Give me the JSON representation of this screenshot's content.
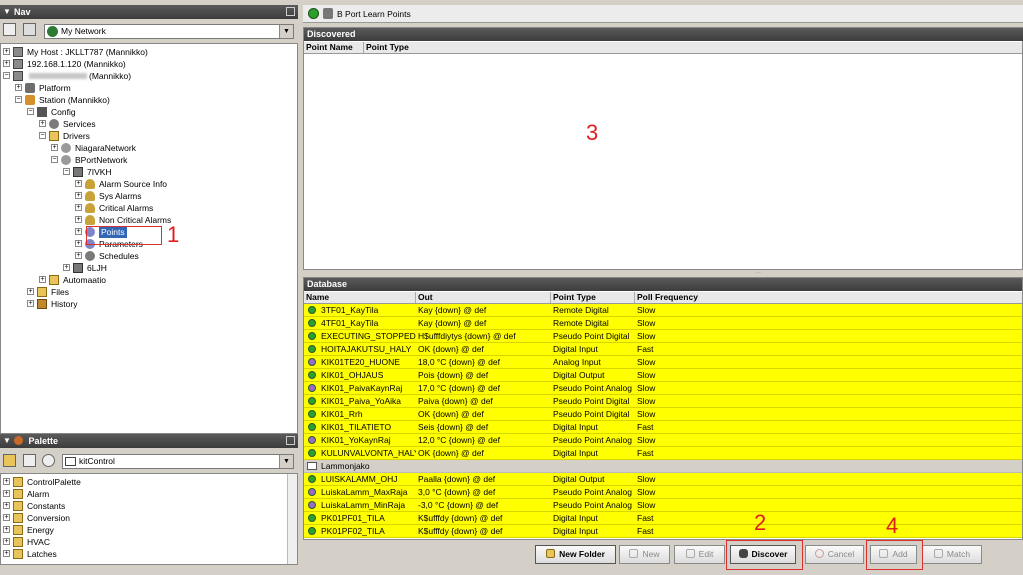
{
  "nav": {
    "title": "Nav",
    "network_combo": "My Network",
    "tree": [
      {
        "label": "My Host : JKLLT787 (Mannikko)"
      },
      {
        "label": "192.168.1.120 (Mannikko)"
      },
      {
        "label": "(Mannikko)"
      },
      {
        "label": "Platform"
      },
      {
        "label": "Station (Mannikko)"
      },
      {
        "label": "Config"
      },
      {
        "label": "Services"
      },
      {
        "label": "Drivers"
      },
      {
        "label": "NiagaraNetwork"
      },
      {
        "label": "BPortNetwork"
      },
      {
        "label": "7IVKH"
      },
      {
        "label": "Alarm Source Info"
      },
      {
        "label": "Sys Alarms"
      },
      {
        "label": "Critical Alarms"
      },
      {
        "label": "Non Critical Alarms"
      },
      {
        "label": "Points"
      },
      {
        "label": "Parameters"
      },
      {
        "label": "Schedules"
      },
      {
        "label": "6LJH"
      },
      {
        "label": "Automaatio"
      },
      {
        "label": "Files"
      },
      {
        "label": "History"
      }
    ]
  },
  "palette": {
    "title": "Palette",
    "combo": "kitControl",
    "items": [
      "ControlPalette",
      "Alarm",
      "Constants",
      "Conversion",
      "Energy",
      "HVAC",
      "Latches"
    ]
  },
  "view": {
    "title": "B Port Learn Points",
    "discovered": {
      "title": "Discovered",
      "columns": [
        "Point Name",
        "Point Type"
      ]
    },
    "database": {
      "title": "Database",
      "columns": [
        "Name",
        "Out",
        "Point Type",
        "Poll Frequency"
      ],
      "rows": [
        {
          "name": "3TF01_KayTila",
          "out": "Kay {down} @ def",
          "type": "Remote Digital",
          "poll": "Slow",
          "color": "#2ca02c"
        },
        {
          "name": "4TF01_KayTila",
          "out": "Kay {down} @ def",
          "type": "Remote Digital",
          "poll": "Slow",
          "color": "#2ca02c"
        },
        {
          "name": "EXECUTING_STOPPED",
          "out": "H$ufffdiytys {down} @ def",
          "type": "Pseudo Point Digital",
          "poll": "Slow",
          "color": "#2ca02c"
        },
        {
          "name": "HOITAJAKUTSU_HALY",
          "out": "OK {down} @ def",
          "type": "Digital Input",
          "poll": "Fast",
          "color": "#2ca02c"
        },
        {
          "name": "KIK01TE20_HUONE",
          "out": "18,0 °C {down} @ def",
          "type": "Analog Input",
          "poll": "Slow",
          "color": "#9b6bc9"
        },
        {
          "name": "KIK01_OHJAUS",
          "out": "Pois {down} @ def",
          "type": "Digital Output",
          "poll": "Slow",
          "color": "#2ca02c"
        },
        {
          "name": "KIK01_PaivaKaynRaj",
          "out": "17,0 °C {down} @ def",
          "type": "Pseudo Point Analog",
          "poll": "Slow",
          "color": "#9b6bc9"
        },
        {
          "name": "KIK01_Paiva_YoAika",
          "out": "Paiva {down} @ def",
          "type": "Pseudo Point Digital",
          "poll": "Slow",
          "color": "#2ca02c"
        },
        {
          "name": "KIK01_Rrh",
          "out": "OK {down} @ def",
          "type": "Pseudo Point Digital",
          "poll": "Slow",
          "color": "#2ca02c"
        },
        {
          "name": "KIK01_TILATIETO",
          "out": "Seis {down} @ def",
          "type": "Digital Input",
          "poll": "Fast",
          "color": "#2ca02c"
        },
        {
          "name": "KIK01_YoKaynRaj",
          "out": "12,0 °C {down} @ def",
          "type": "Pseudo Point Analog",
          "poll": "Slow",
          "color": "#9b6bc9"
        },
        {
          "name": "KULUNVALVONTA_HALY",
          "out": "OK {down} @ def",
          "type": "Digital Input",
          "poll": "Fast",
          "color": "#2ca02c"
        },
        {
          "name": "Lammonjako",
          "out": "",
          "type": "",
          "poll": "",
          "color": "",
          "folder": true
        },
        {
          "name": "LUISKALAMM_OHJ",
          "out": "Paalla {down} @ def",
          "type": "Digital Output",
          "poll": "Slow",
          "color": "#2ca02c"
        },
        {
          "name": "LuiskaLamm_MaxRaja",
          "out": "3,0 °C {down} @ def",
          "type": "Pseudo Point Analog",
          "poll": "Slow",
          "color": "#9b6bc9"
        },
        {
          "name": "LuiskaLamm_MinRaja",
          "out": "-3,0 °C {down} @ def",
          "type": "Pseudo Point Analog",
          "poll": "Slow",
          "color": "#9b6bc9"
        },
        {
          "name": "PK01PF01_TILA",
          "out": "K$ufffdy {down} @ def",
          "type": "Digital Input",
          "poll": "Fast",
          "color": "#2ca02c"
        },
        {
          "name": "PK01PF02_TILA",
          "out": "K$ufffdy {down} @ def",
          "type": "Digital Input",
          "poll": "Fast",
          "color": "#2ca02c"
        }
      ]
    },
    "buttons": {
      "new_folder": "New Folder",
      "new": "New",
      "edit": "Edit",
      "discover": "Discover",
      "cancel": "Cancel",
      "add": "Add",
      "match": "Match"
    }
  },
  "annotations": [
    "1",
    "2",
    "3",
    "4"
  ],
  "colors": {
    "row_highlight": "#ffff00",
    "annotation": "#e01e1e",
    "selection": "#3167b5"
  }
}
